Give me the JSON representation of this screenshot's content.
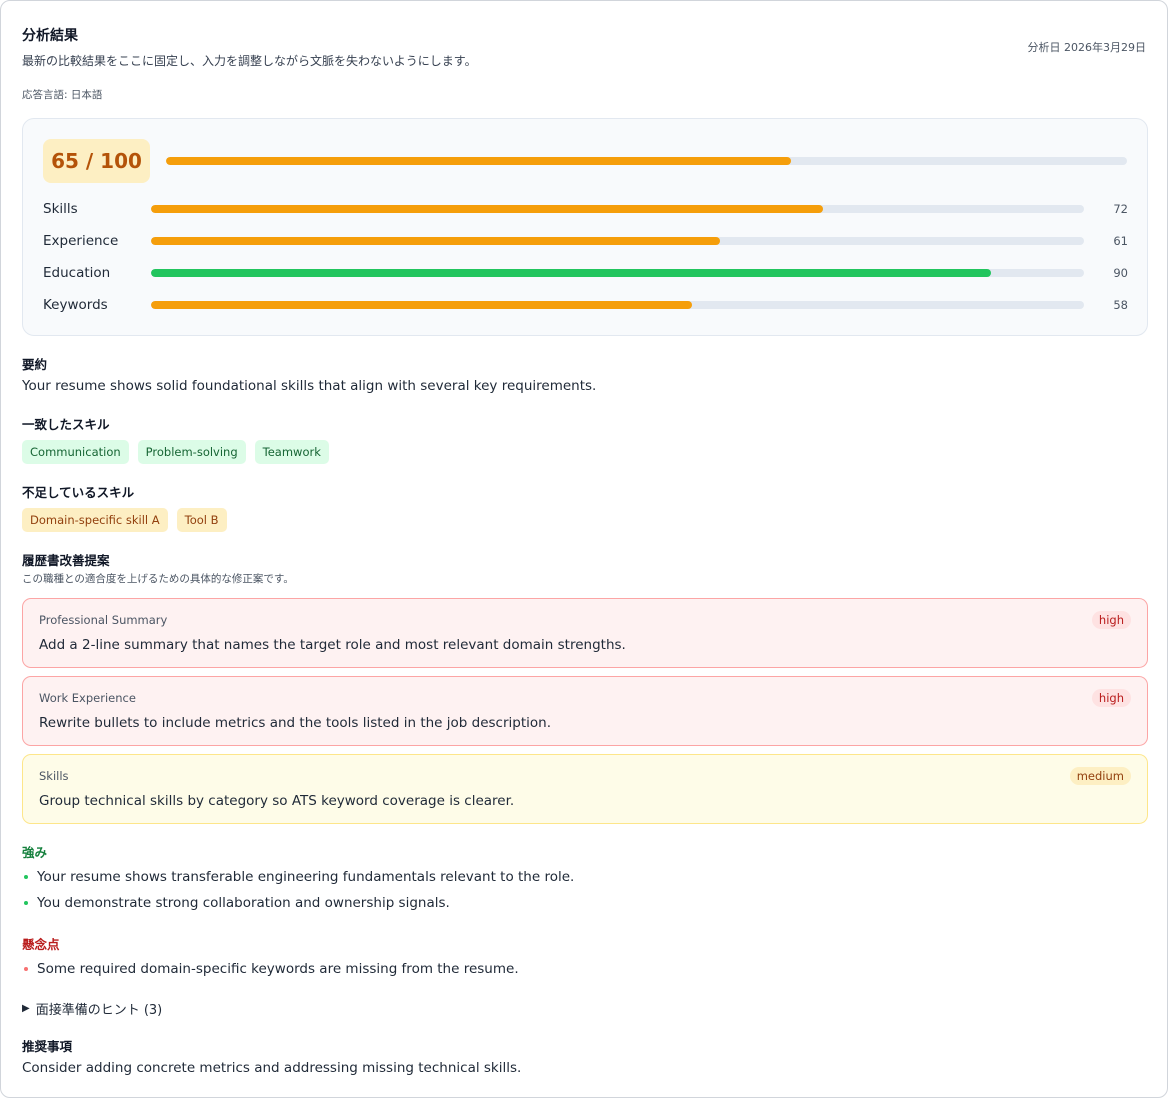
{
  "header": {
    "title": "分析結果",
    "subtitle": "最新の比較結果をここに固定し、入力を調整しながら文脈を失わないようにします。",
    "language": "応答言語: 日本語",
    "date": "分析日 2026年3月29日"
  },
  "score": {
    "overall_label": "65 / 100",
    "overall_value": 65,
    "overall_color": "#f59e0b",
    "categories": [
      {
        "label": "Skills",
        "value": 72,
        "value_label": "72",
        "color": "#f59e0b"
      },
      {
        "label": "Experience",
        "value": 61,
        "value_label": "61",
        "color": "#f59e0b"
      },
      {
        "label": "Education",
        "value": 90,
        "value_label": "90",
        "color": "#22c55e"
      },
      {
        "label": "Keywords",
        "value": 58,
        "value_label": "58",
        "color": "#f59e0b"
      }
    ]
  },
  "summary": {
    "heading": "要約",
    "text": "Your resume shows solid foundational skills that align with several key requirements."
  },
  "matched_skills": {
    "heading": "一致したスキル",
    "items": [
      "Communication",
      "Problem-solving",
      "Teamwork"
    ]
  },
  "missing_skills": {
    "heading": "不足しているスキル",
    "items": [
      "Domain-specific skill A",
      "Tool B"
    ]
  },
  "suggestions": {
    "heading": "履歴書改善提案",
    "note": "この職種との適合度を上げるための具体的な修正案です。",
    "items": [
      {
        "section": "Professional Summary",
        "text": "Add a 2-line summary that names the target role and most relevant domain strengths.",
        "priority": "high"
      },
      {
        "section": "Work Experience",
        "text": "Rewrite bullets to include metrics and the tools listed in the job description.",
        "priority": "high"
      },
      {
        "section": "Skills",
        "text": "Group technical skills by category so ATS keyword coverage is clearer.",
        "priority": "medium"
      }
    ]
  },
  "strengths": {
    "heading": "強み",
    "items": [
      "Your resume shows transferable engineering fundamentals relevant to the role.",
      "You demonstrate strong collaboration and ownership signals."
    ]
  },
  "concerns": {
    "heading": "懸念点",
    "items": [
      "Some required domain-specific keywords are missing from the resume."
    ]
  },
  "interview_tips": {
    "label": "面接準備のヒント (3)"
  },
  "recommendation": {
    "heading": "推奨事項",
    "text": "Consider adding concrete metrics and addressing missing technical skills."
  }
}
